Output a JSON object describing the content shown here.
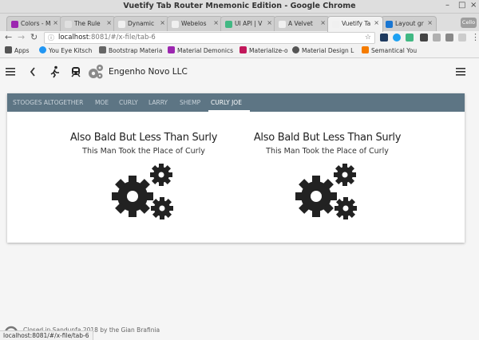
{
  "window": {
    "title": "Vuetify Tab Router Mnemonic Edition - Google Chrome"
  },
  "tabs": [
    {
      "label": "Colors - M",
      "color": "#9c27b0"
    },
    {
      "label": "The Rule",
      "color": "#e0e0e0"
    },
    {
      "label": "Dynamic",
      "color": "#f0f0f0"
    },
    {
      "label": "Webelos",
      "color": "#f0f0f0"
    },
    {
      "label": "UI API | V",
      "color": "#41b883"
    },
    {
      "label": "A Velvet",
      "color": "#f0f0f0"
    },
    {
      "label": "Vuetify Ta",
      "color": "#f0f0f0",
      "active": true
    },
    {
      "label": "Layout gr",
      "color": "#1976d2"
    }
  ],
  "profile_badge": "Cello",
  "address": {
    "host": "localhost",
    "rest": ":8081/#/x-file/tab-6"
  },
  "bookmarks": [
    {
      "label": "Apps",
      "color": "#555555"
    },
    {
      "label": "You Eye Kitsch",
      "color": "#2196f3"
    },
    {
      "label": "Bootstrap Materia",
      "color": "#666666"
    },
    {
      "label": "Material Demonics",
      "color": "#9c27b0"
    },
    {
      "label": "Materialize-o",
      "color": "#c2185b"
    },
    {
      "label": "Material Design L",
      "color": "#555555"
    },
    {
      "label": "Semantical You",
      "color": "#f57c00"
    }
  ],
  "app": {
    "company": "Engenho Novo LLC"
  },
  "stooge_tabs": [
    "Stooges Altogether",
    "Moe",
    "Curly",
    "Larry",
    "Shemp",
    "Curly Joe"
  ],
  "active_tab_index": 5,
  "panels": [
    {
      "heading": "Also Bald But Less Than Surly",
      "subheading": "This Man Took the Place of Curly"
    },
    {
      "heading": "Also Bald But Less Than Surly",
      "subheading": "This Man Took the Place of Curly"
    }
  ],
  "footer": {
    "text": "Closed in Sandunfa 2018 by the Gian Brafinia"
  },
  "status_url": "localhost:8081/#/x-file/tab-6",
  "colors": {
    "tabbar": "#5d7584",
    "active_tab": "#ffffff",
    "inactive_tab": "#c9d3da"
  }
}
